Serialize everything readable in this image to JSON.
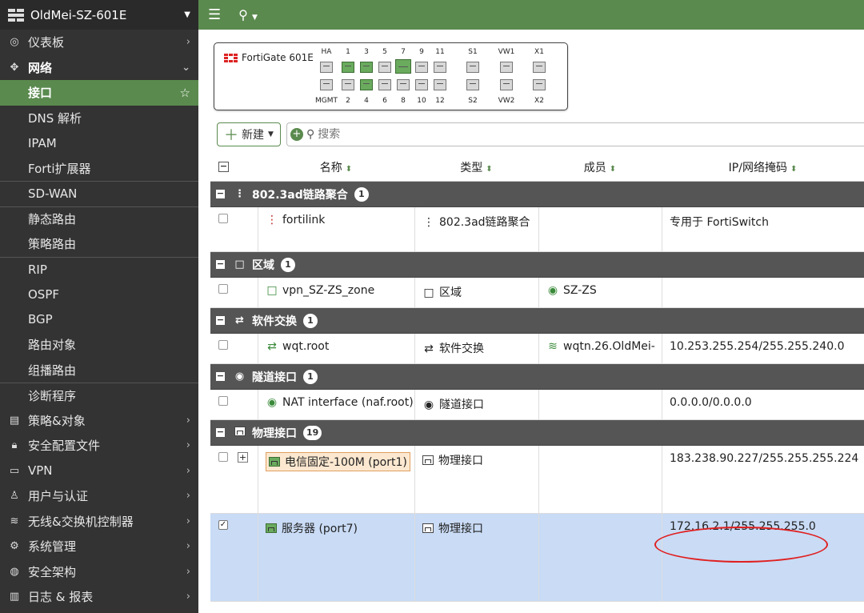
{
  "app": {
    "device_name": "OldMei-SZ-601E"
  },
  "sidebar": {
    "items": [
      {
        "label": "仪表板",
        "icon": "dashboard-icon",
        "level": "top"
      },
      {
        "label": "网络",
        "icon": "network-move-icon",
        "level": "top-open"
      },
      {
        "label": "接口",
        "level": "sub-active"
      },
      {
        "label": "DNS 解析",
        "level": "sub"
      },
      {
        "label": "IPAM",
        "level": "sub"
      },
      {
        "label": "Forti扩展器",
        "level": "sub"
      },
      {
        "label": "SD-WAN",
        "level": "sub-sep"
      },
      {
        "label": "静态路由",
        "level": "sub-sep"
      },
      {
        "label": "策略路由",
        "level": "sub"
      },
      {
        "label": "RIP",
        "level": "sub-sep"
      },
      {
        "label": "OSPF",
        "level": "sub"
      },
      {
        "label": "BGP",
        "level": "sub"
      },
      {
        "label": "路由对象",
        "level": "sub"
      },
      {
        "label": "组播路由",
        "level": "sub"
      },
      {
        "label": "诊断程序",
        "level": "sub-sep"
      },
      {
        "label": "策略&对象",
        "icon": "policy-icon",
        "level": "top"
      },
      {
        "label": "安全配置文件",
        "icon": "lock-icon",
        "level": "top"
      },
      {
        "label": "VPN",
        "icon": "laptop-icon",
        "level": "top"
      },
      {
        "label": "用户与认证",
        "icon": "user-icon",
        "level": "top"
      },
      {
        "label": "无线&交换机控制器",
        "icon": "wifi-icon",
        "level": "top"
      },
      {
        "label": "系统管理",
        "icon": "gear-icon",
        "level": "top"
      },
      {
        "label": "安全架构",
        "icon": "globe-icon",
        "level": "top"
      },
      {
        "label": "日志 & 报表",
        "icon": "chart-icon",
        "level": "top"
      }
    ]
  },
  "device": {
    "model": "FortiGate 601E",
    "top_labels": [
      "HA",
      "1",
      "3",
      "5",
      "7",
      "9",
      "11",
      "S1",
      "VW1",
      "X1"
    ],
    "bottom_labels": [
      "MGMT",
      "2",
      "4",
      "6",
      "8",
      "10",
      "12",
      "S2",
      "VW2",
      "X2"
    ],
    "top_up": [
      false,
      true,
      true,
      false,
      true,
      false,
      false,
      false,
      false,
      false
    ],
    "bottom_up": [
      false,
      false,
      true,
      false,
      false,
      false,
      false,
      false,
      false,
      false
    ]
  },
  "toolbar": {
    "new_label": "新建",
    "search_placeholder": "搜索"
  },
  "table": {
    "columns": [
      "名称",
      "类型",
      "成员",
      "IP/网络掩码"
    ],
    "groups": [
      {
        "label": "802.3ad链路聚合",
        "count": "1",
        "icon": "aggregate-icon",
        "rows": [
          {
            "name": "fortilink",
            "name_icon": "aggregate-icon",
            "type": "802.3ad链路聚合",
            "type_icon": "aggregate-icon",
            "member": "",
            "ip": "专用于 FortiSwitch",
            "height": 56
          }
        ]
      },
      {
        "label": "区域",
        "count": "1",
        "icon": "zone-icon",
        "rows": [
          {
            "name": "vpn_SZ-ZS_zone",
            "name_icon": "zone-icon",
            "type": "区域",
            "type_icon": "zone-icon",
            "member": "SZ-ZS",
            "member_icon": "tunnel-icon",
            "ip": "",
            "height": 38
          }
        ]
      },
      {
        "label": "软件交换",
        "count": "1",
        "icon": "switch-icon",
        "rows": [
          {
            "name": "wqt.root",
            "name_icon": "switch-icon",
            "type": "软件交换",
            "type_icon": "switch-icon",
            "member": "wqtn.26.OldMei-",
            "member_icon": "wifi-icon",
            "ip": "10.253.255.254/255.255.240.0",
            "height": 38
          }
        ]
      },
      {
        "label": "隧道接口",
        "count": "1",
        "icon": "tunnel-icon",
        "rows": [
          {
            "name": "NAT interface (naf.root)",
            "name_icon": "tunnel-icon",
            "type": "隧道接口",
            "type_icon": "tunnel-icon",
            "member": "",
            "ip": "0.0.0.0/0.0.0.0",
            "height": 38
          }
        ]
      },
      {
        "label": "物理接口",
        "count": "19",
        "icon": "port-icon",
        "rows": [
          {
            "name": "电信固定-100M (port1)",
            "name_icon": "port-icon",
            "type": "物理接口",
            "type_icon": "port-icon",
            "member": "",
            "ip": "183.238.90.227/255.255.255.224",
            "height": 85,
            "tagged": true,
            "expand": "+"
          },
          {
            "name": "服务器 (port7)",
            "name_icon": "port-icon",
            "type": "物理接口",
            "type_icon": "port-icon",
            "member": "",
            "ip": "172.16.2.1/255.255.255.0",
            "height": 110,
            "selected": true
          }
        ]
      }
    ]
  }
}
